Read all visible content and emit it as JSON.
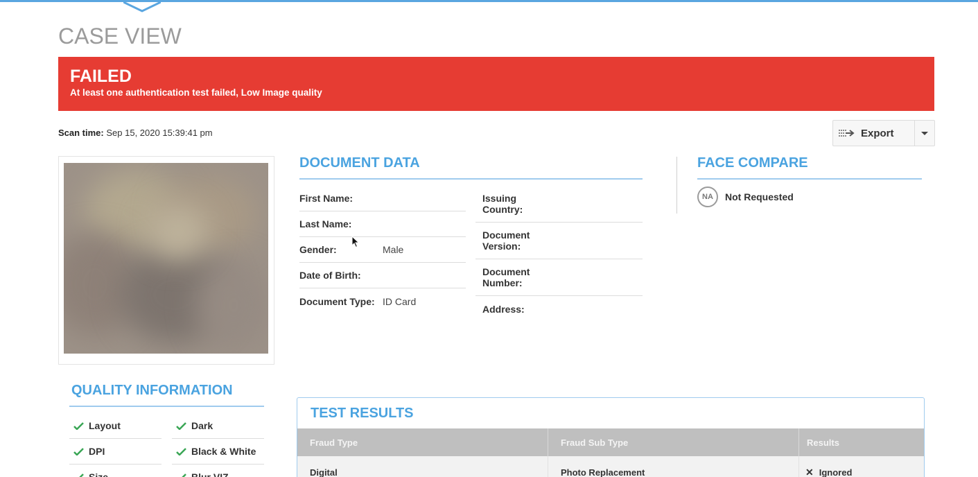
{
  "page_title": "CASE VIEW",
  "status": {
    "title": "FAILED",
    "description": "At least one authentication test failed, Low Image quality",
    "color": "#e63c33"
  },
  "scan_time": {
    "label": "Scan time:",
    "value": "Sep 15, 2020 15:39:41 pm"
  },
  "export": {
    "label": "Export",
    "icon": "export-icon",
    "dropdown_icon": "caret-down-icon"
  },
  "document_data": {
    "heading": "DOCUMENT DATA",
    "left_fields": [
      {
        "label": "First Name:",
        "value": ""
      },
      {
        "label": "Last Name:",
        "value": ""
      },
      {
        "label": "Gender:",
        "value": "Male"
      },
      {
        "label": "Date of Birth:",
        "value": ""
      },
      {
        "label": "Document Type:",
        "value": "ID Card"
      }
    ],
    "right_fields": [
      {
        "label_line1": "Issuing",
        "label_line2": "Country:",
        "value": ""
      },
      {
        "label_line1": "Document",
        "label_line2": "Version:",
        "value": ""
      },
      {
        "label_line1": "Document",
        "label_line2": "Number:",
        "value": ""
      },
      {
        "label_line1": "Address:",
        "label_line2": "",
        "value": ""
      }
    ]
  },
  "face_compare": {
    "heading": "FACE COMPARE",
    "badge": "NA",
    "status": "Not Requested"
  },
  "quality_information": {
    "heading": "QUALITY INFORMATION",
    "items": [
      "Layout",
      "Dark",
      "DPI",
      "Black & White",
      "Size",
      "Blur VIZ"
    ],
    "check_color": "#3aa655"
  },
  "test_results": {
    "heading": "TEST RESULTS",
    "columns": [
      "Fraud Type",
      "Fraud Sub Type",
      "Results"
    ],
    "rows": [
      {
        "fraud_type": "Digital",
        "fraud_sub_type": "Photo Replacement",
        "result": "Ignored",
        "result_icon": "x-icon"
      }
    ]
  },
  "colors": {
    "accent": "#4aa3e0",
    "topbar": "#5aa6e0",
    "header_gray": "#bfbfbf"
  }
}
